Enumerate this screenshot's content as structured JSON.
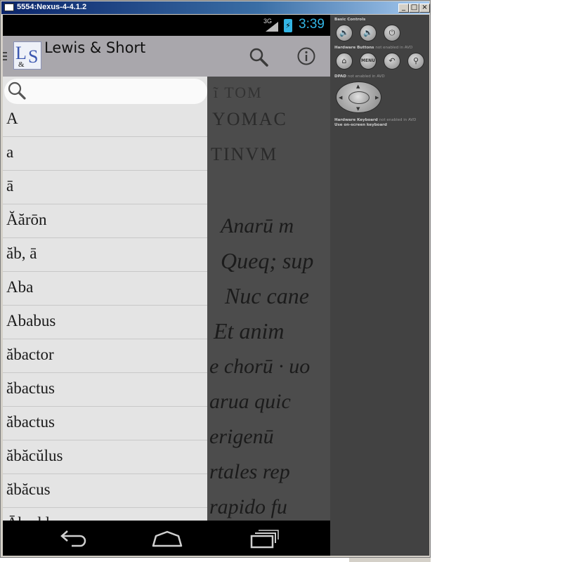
{
  "window": {
    "title": "5554:Nexus-4-4.1.2",
    "minimize_glyph": "_",
    "maximize_glyph": "□",
    "close_glyph": "×"
  },
  "status_bar": {
    "network": "3G",
    "time": "3:39"
  },
  "action_bar": {
    "app_title": "Lewis & Short",
    "logo": {
      "l": "L",
      "s": "S",
      "amp": "&"
    },
    "icons": [
      "search-icon",
      "info-icon"
    ]
  },
  "drawer": {
    "search": {
      "value": "",
      "placeholder": ""
    },
    "words": [
      "A",
      "a",
      "ā",
      "Ăărōn",
      "ăb, ā",
      "Aba",
      "Ababus",
      "ăbactor",
      "ăbactus",
      "ăbactus",
      "ăbăcŭlus",
      "ăbăcus",
      "Ābaddon"
    ]
  },
  "manuscript_lines": [
    "ĩ TOM",
    "YOMAC",
    "TINVM",
    "Anarū m",
    "Queq; sup",
    "Nuc cane",
    "Et anim",
    "e chorū · uo",
    "arua quic",
    "erigenū",
    "rtales rep",
    "rapido fu"
  ],
  "nav_bar": {
    "icons": [
      "back-icon",
      "home-icon",
      "recent-apps-icon"
    ]
  },
  "controls": {
    "basic_label": "Basic Controls",
    "hardware_label": "Hardware Buttons",
    "hardware_note": "not enabled in AVD",
    "menu_label": "MENU",
    "dpad_label": "DPAD",
    "dpad_note": "not enabled in AVD",
    "keyboard_label": "Hardware Keyboard",
    "keyboard_note": "not enabled in AVD",
    "keyboard_note2": "Use on-screen keyboard"
  },
  "colors": {
    "accent": "#33b5e5",
    "action_bar": "#a9a7ac",
    "drawer_bg": "#e4e4e4",
    "controls_bg": "#424242",
    "title_bar": "#0a246a"
  }
}
